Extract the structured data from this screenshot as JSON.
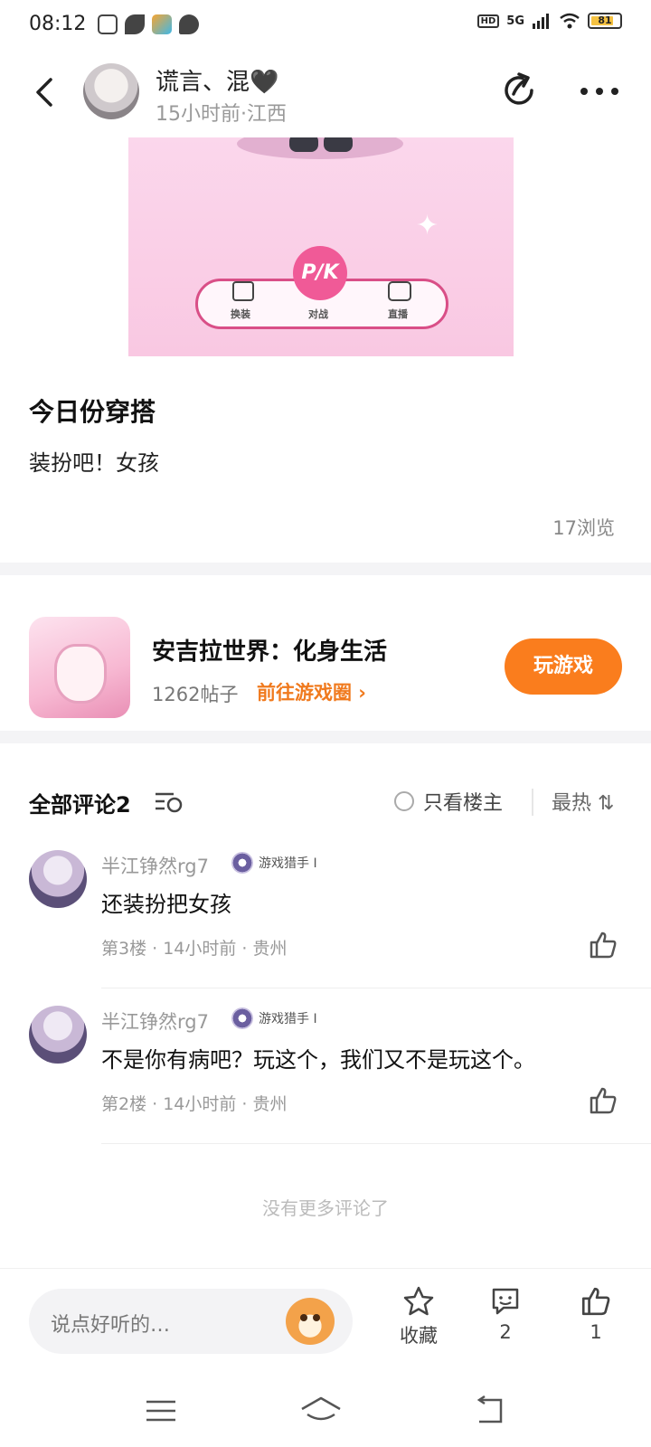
{
  "status_bar": {
    "time": "08:12",
    "network": "5G",
    "hd": "HD",
    "battery": "81",
    "battery_level": 0.81,
    "icons": [
      "notification-app-icon",
      "leaf-icon",
      "video-app-icon",
      "chat-bubble-icon",
      "signal-icon",
      "wifi-icon",
      "battery-icon"
    ]
  },
  "header": {
    "author_name": "谎言、混🖤",
    "post_meta": "15小时前·江西",
    "icons": [
      "back-arrow-icon",
      "share-icon",
      "more-icon"
    ]
  },
  "post": {
    "image_labels": [
      "换装",
      "对战",
      "直播"
    ],
    "image_badge": "P/K",
    "title": "今日份穿搭",
    "body": "装扮吧！女孩",
    "views": "17浏览"
  },
  "game_card": {
    "name": "安吉拉世界：化身生活",
    "posts": "1262帖子",
    "circle_link": "前往游戏圈 ›",
    "play_button": "玩游戏"
  },
  "comments_header": {
    "title": "全部评论2",
    "owner_only": "只看楼主",
    "sort": "最热 ⇅"
  },
  "comments": [
    {
      "user": "半江铮然rg7",
      "badge": "游戏猎手 I",
      "text": "还装扮把女孩",
      "meta": "第3楼 · 14小时前 · 贵州"
    },
    {
      "user": "半江铮然rg7",
      "badge": "游戏猎手 I",
      "text": "不是你有病吧？玩这个，我们又不是玩这个。",
      "meta": "第2楼 · 14小时前 · 贵州"
    }
  ],
  "no_more": "没有更多评论了",
  "bottom_bar": {
    "input_placeholder": "说点好听的…",
    "favorite_label": "收藏",
    "comment_count": "2",
    "like_count": "1"
  },
  "colors": {
    "accent_orange": "#fa7d1d",
    "link_orange": "#f07a1e",
    "pink_image": "#fbd7ec"
  }
}
